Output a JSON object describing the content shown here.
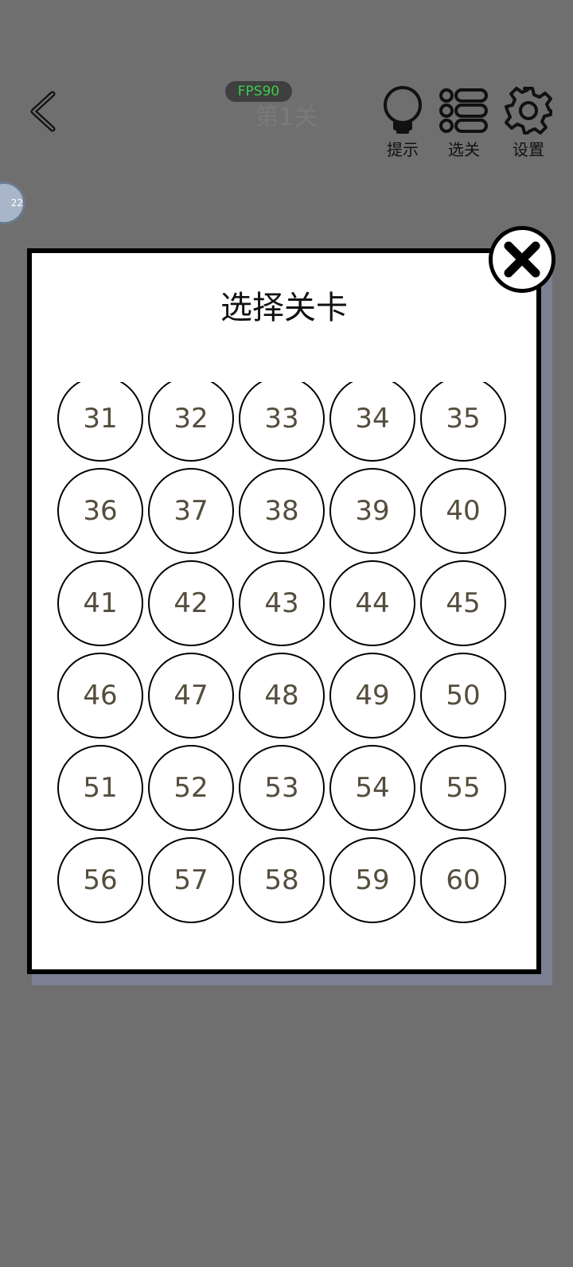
{
  "header": {
    "back_icon": "chevron-left-icon",
    "fps_badge": "FPS90",
    "level_title": "第1关",
    "tools": [
      {
        "icon": "lightbulb-icon",
        "label": "提示"
      },
      {
        "icon": "list-icon",
        "label": "选关"
      },
      {
        "icon": "gear-icon",
        "label": "设置"
      }
    ]
  },
  "side_badge": "22",
  "dialog": {
    "title": "选择关卡",
    "close_icon": "close-icon",
    "levels": [
      "31",
      "32",
      "33",
      "34",
      "35",
      "36",
      "37",
      "38",
      "39",
      "40",
      "41",
      "42",
      "43",
      "44",
      "45",
      "46",
      "47",
      "48",
      "49",
      "50",
      "51",
      "52",
      "53",
      "54",
      "55",
      "56",
      "57",
      "58",
      "59",
      "60"
    ]
  },
  "colors": {
    "overlay": "#6f6f6f",
    "fps_text": "#3ccb4a",
    "level_text": "#544d3d",
    "modal_shadow": "#7b8193"
  }
}
